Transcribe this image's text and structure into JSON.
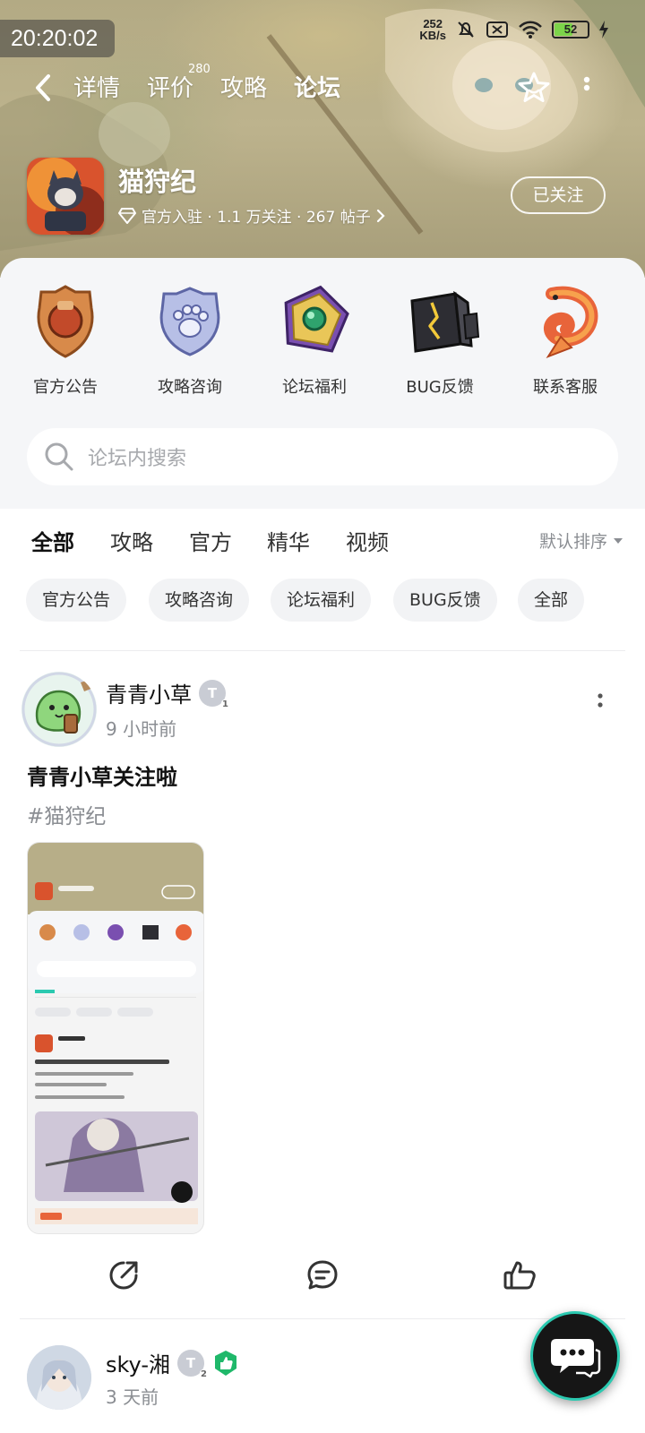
{
  "status": {
    "time": "20:20:02",
    "net_speed_value": "252",
    "net_speed_unit": "KB/s",
    "battery": "52"
  },
  "nav": {
    "tabs": [
      {
        "label": "详情"
      },
      {
        "label": "评价",
        "count": "280"
      },
      {
        "label": "攻略"
      },
      {
        "label": "论坛"
      }
    ],
    "active_tab": "论坛"
  },
  "game": {
    "name": "猫狩纪",
    "meta": "官方入驻 · 1.1 万关注 · 267 帖子",
    "follow_label": "已关注"
  },
  "categories": [
    {
      "label": "官方公告",
      "icon": "shield-badge-icon"
    },
    {
      "label": "攻略咨询",
      "icon": "paw-badge-icon"
    },
    {
      "label": "论坛福利",
      "icon": "gem-badge-icon"
    },
    {
      "label": "BUG反馈",
      "icon": "cracked-box-icon"
    },
    {
      "label": "联系客服",
      "icon": "koi-fish-icon"
    }
  ],
  "search": {
    "placeholder": "论坛内搜索"
  },
  "filter_tabs": [
    "全部",
    "攻略",
    "官方",
    "精华",
    "视频"
  ],
  "active_filter": "全部",
  "sort_label": "默认排序",
  "chips": [
    "官方公告",
    "攻略咨询",
    "论坛福利",
    "BUG反馈",
    "全部"
  ],
  "posts": [
    {
      "author": "青青小草",
      "level": "T",
      "level_num": "1",
      "time": "9 小时前",
      "title": "青青小草关注啦",
      "tag": "#猫狩纪"
    },
    {
      "author": "sky-湘",
      "level": "T",
      "level_num": "2",
      "time": "3 天前"
    }
  ],
  "colors": {
    "accent": "#2bc9b0",
    "panel": "#f5f6f8",
    "muted": "#8a8d92"
  }
}
